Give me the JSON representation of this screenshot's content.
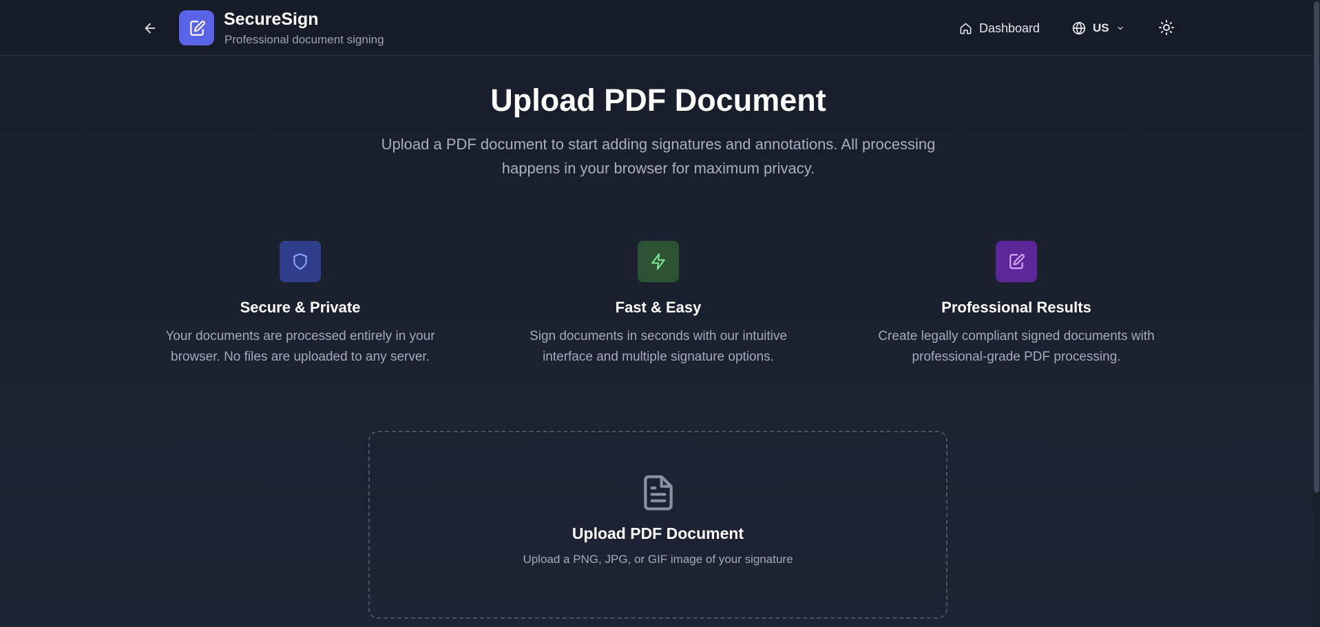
{
  "header": {
    "brand_title": "SecureSign",
    "brand_subtitle": "Professional document signing",
    "nav_dashboard": "Dashboard",
    "language": "US"
  },
  "hero": {
    "title": "Upload PDF Document",
    "subtitle": "Upload a PDF document to start adding signatures and annotations. All processing happens in your browser for maximum privacy."
  },
  "features": [
    {
      "icon": "shield-icon",
      "color": "#2e3e8a",
      "title": "Secure & Private",
      "description": "Your documents are processed entirely in your browser. No files are uploaded to any server."
    },
    {
      "icon": "lightning-icon",
      "color": "#2c5233",
      "title": "Fast & Easy",
      "description": "Sign documents in seconds with our intuitive interface and multiple signature options."
    },
    {
      "icon": "document-pen-icon",
      "color": "#5a2799",
      "title": "Professional Results",
      "description": "Create legally compliant signed documents with professional-grade PDF processing."
    }
  ],
  "upload": {
    "title": "Upload PDF Document",
    "description": "Upload a PNG, JPG, or GIF image of your signature"
  },
  "colors": {
    "accent": "#5b63e6",
    "background": "#1c2130",
    "header": "#161b28"
  }
}
